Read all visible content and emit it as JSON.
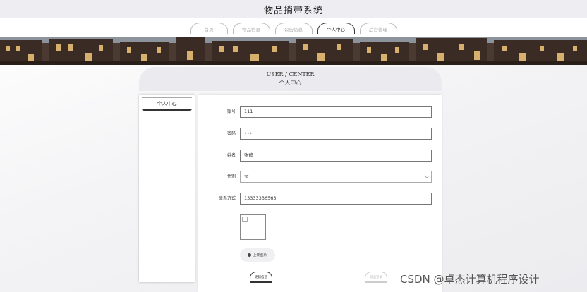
{
  "site": {
    "title": "物品捎带系统"
  },
  "nav": {
    "tabs": [
      {
        "label": "首页",
        "active": false
      },
      {
        "label": "物品信息",
        "active": false
      },
      {
        "label": "公告信息",
        "active": false
      },
      {
        "label": "个人中心",
        "active": true
      },
      {
        "label": "后台管理",
        "active": false
      }
    ]
  },
  "header": {
    "en": "USER / CENTER",
    "cn": "个人中心"
  },
  "sidebar": {
    "items": [
      {
        "label": "个人中心"
      }
    ]
  },
  "form": {
    "fields": [
      {
        "label": "账号",
        "value": "111"
      },
      {
        "label": "密码",
        "value": "•••"
      },
      {
        "label": "姓名",
        "value": "张静"
      },
      {
        "label": "性别",
        "value": "女"
      },
      {
        "label": "联系方式",
        "value": "13333336563"
      }
    ],
    "upload_label": "上传图片",
    "update_label": "更新信息",
    "logout_label": "退出登录"
  },
  "watermark": "CSDN @卓杰计算机程序设计",
  "colors": {
    "header_bg": "#ebebef",
    "title_bar_bg": "#eeeef2",
    "active_tab_border": "#333333"
  }
}
